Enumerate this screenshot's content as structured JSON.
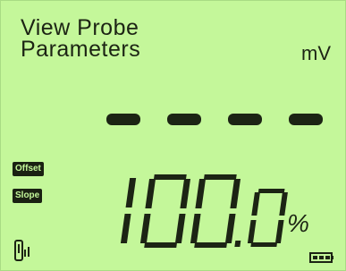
{
  "display": {
    "title_line1": "View Probe",
    "title_line2": "Parameters",
    "unit": "mV",
    "dashes": "- - - -",
    "indicators": {
      "offset": "Offset",
      "slope": "Slope"
    },
    "reading": "100.0",
    "reading_unit": "%"
  },
  "icons": {
    "probe": "probe-signal-icon",
    "battery": "battery-icon"
  },
  "colors": {
    "lcd_bg": "#c4f79a",
    "segment": "#1c2414"
  }
}
